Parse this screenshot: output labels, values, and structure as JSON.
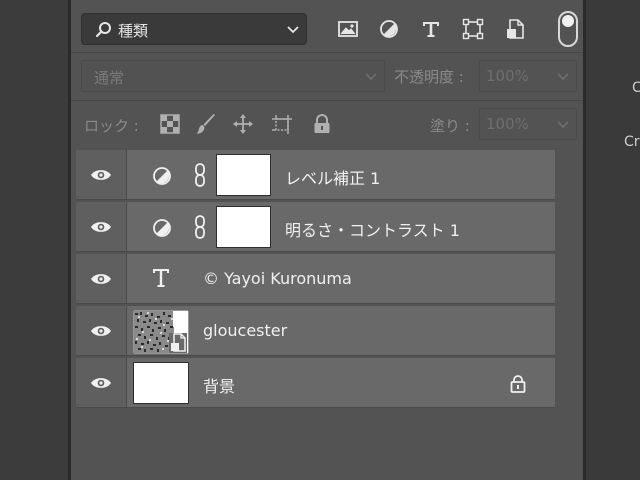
{
  "filter": {
    "kind_label": "種類"
  },
  "blend": {
    "mode": "通常",
    "opacity_label": "不透明度 :",
    "opacity_value": "100%",
    "lock_label": "ロック :",
    "fill_label": "塗り :",
    "fill_value": "100%"
  },
  "right_panel": {
    "labels": [
      "C",
      "Cr"
    ]
  },
  "layers": [
    {
      "name": "レベル補正 1",
      "type": "adjustment",
      "icon": "half-circle-icon"
    },
    {
      "name": "明るさ・コントラスト 1",
      "type": "adjustment",
      "icon": "half-circle-icon"
    },
    {
      "name": "© Yayoi Kuronuma",
      "type": "text",
      "icon": "T"
    },
    {
      "name": "gloucester",
      "type": "smart-object"
    },
    {
      "name": "背景",
      "type": "background",
      "locked": true
    }
  ]
}
